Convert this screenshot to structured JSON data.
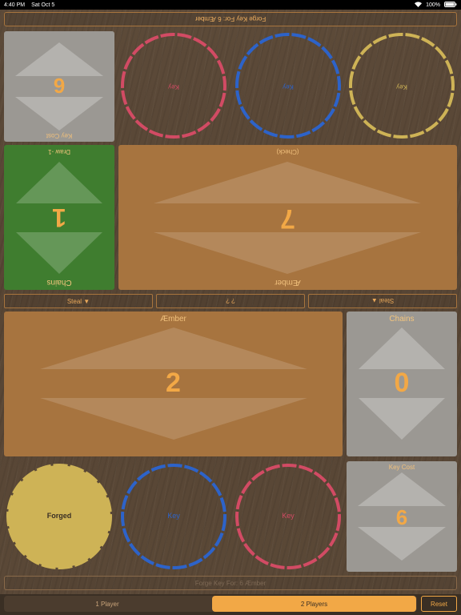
{
  "status_bar": {
    "time": "4:40 PM",
    "date": "Sat Oct 5",
    "battery": "100%"
  },
  "colors": {
    "amber": "#a7743f",
    "gray": "#9b9893",
    "green": "#3f7d2f",
    "red": "#d24b64",
    "blue": "#2d63c9",
    "yellow": "#ceb356",
    "accent": "#f2a846"
  },
  "top_player": {
    "forge_label": "Forge Key For: 6 Æmber",
    "key_cost_label": "Key Cost",
    "key_cost_value": "6",
    "keys": [
      {
        "label": "Key",
        "color": "red",
        "forged": false
      },
      {
        "label": "Key",
        "color": "blue",
        "forged": false
      },
      {
        "label": "Key",
        "color": "yellow",
        "forged": false
      }
    ],
    "chains_label": "Chains",
    "chains_value": "1",
    "chains_sub": "Draw -1",
    "aember_label": "Æmber",
    "aember_value": "7",
    "aember_sub": "(Check)"
  },
  "middle_bar": {
    "steal_left": "Steal ▼",
    "question": "? ?",
    "steal_right": "Steal ▲"
  },
  "bottom_player": {
    "aember_label": "Æmber",
    "aember_value": "2",
    "chains_label": "Chains",
    "chains_value": "0",
    "key_cost_label": "Key Cost",
    "key_cost_value": "6",
    "keys": [
      {
        "label": "Forged",
        "color": "yellow",
        "forged": true
      },
      {
        "label": "Key",
        "color": "blue",
        "forged": false
      },
      {
        "label": "Key",
        "color": "red",
        "forged": false
      }
    ],
    "forge_label": "Forge Key For: 6 Æmber"
  },
  "footer": {
    "one_player": "1 Player",
    "two_players": "2 Players",
    "reset": "Reset",
    "selected": "2 Players"
  }
}
